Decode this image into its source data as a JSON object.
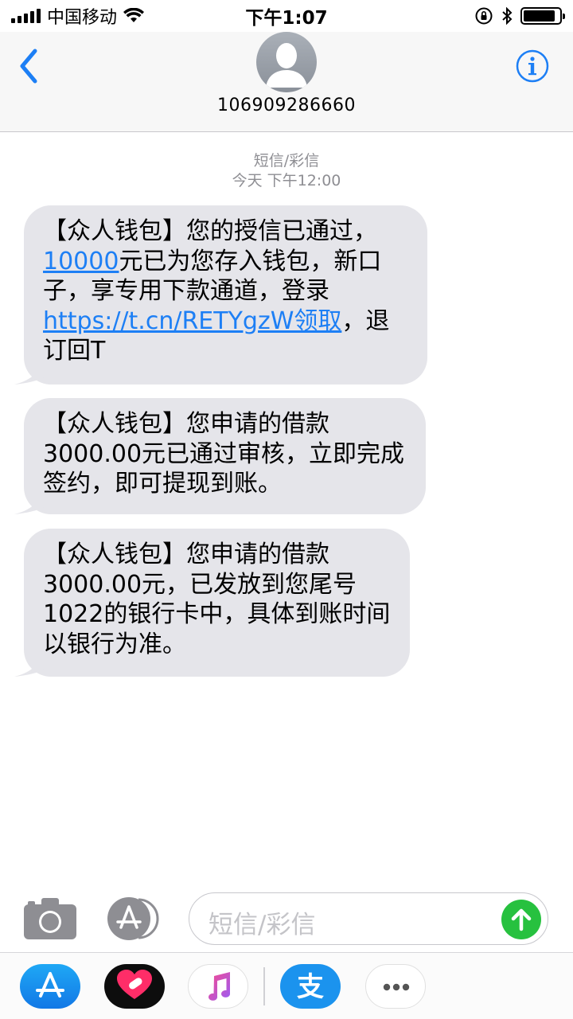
{
  "status_bar": {
    "carrier": "中国移动",
    "time": "下午1:07"
  },
  "header": {
    "contact_number": "106909286660"
  },
  "conversation": {
    "service_label": "短信/彩信",
    "timestamp": "今天 下午12:00",
    "messages": [
      {
        "text_before": "【众人钱包】您的授信已通过，",
        "amount_link": "10000",
        "text_middle": "元已为您存入钱包，新口子，享专用下款通道，登录 ",
        "url_link": "https://t.cn/RETYgzW领取",
        "text_after": "，退订回T"
      },
      {
        "text": "【众人钱包】您申请的借款3000.00元已通过审核，立即完成签约，即可提现到账。"
      },
      {
        "text": "【众人钱包】您申请的借款3000.00元，已发放到您尾号1022的银行卡中，具体到账时间以银行为准。"
      }
    ]
  },
  "composer": {
    "placeholder": "短信/彩信",
    "send_color": "#27c13f"
  },
  "app_drawer": {
    "alipay_glyph": "支",
    "more_glyph": "•••"
  },
  "colors": {
    "link": "#1d7ff5",
    "bubble": "#e5e5ea",
    "ios_blue": "#1d7ff5"
  }
}
